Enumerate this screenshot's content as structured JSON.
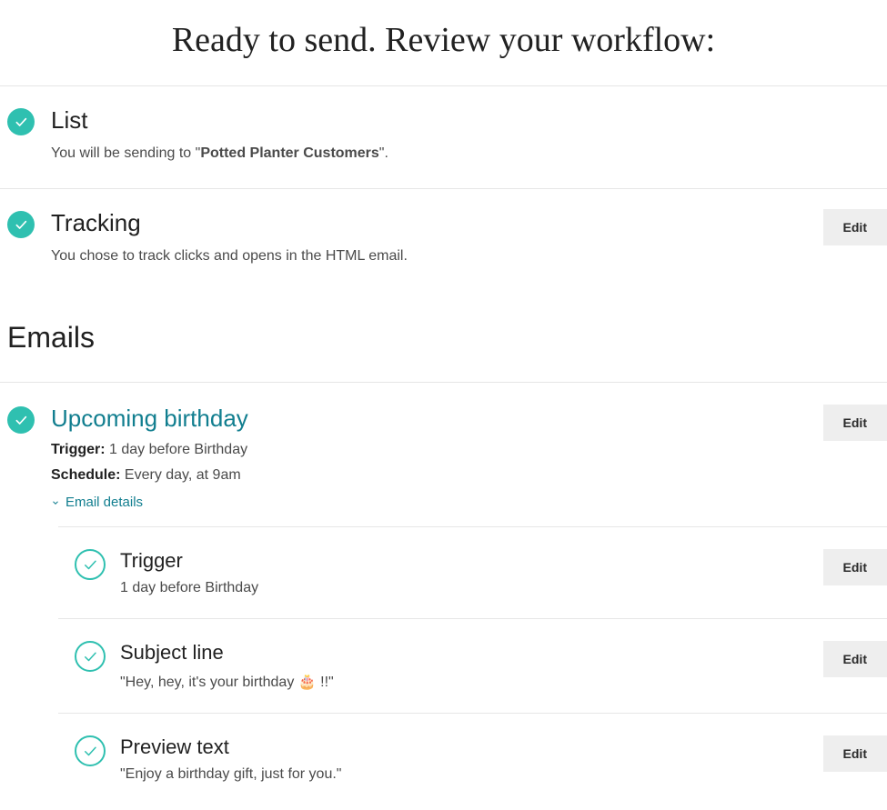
{
  "title": "Ready to send. Review your workflow:",
  "sections": {
    "list": {
      "title": "List",
      "desc_prefix": "You will be sending to \"",
      "desc_bold": "Potted Planter Customers",
      "desc_suffix": "\"."
    },
    "tracking": {
      "title": "Tracking",
      "desc": "You chose to track clicks and opens in the HTML email.",
      "edit": "Edit"
    }
  },
  "emails_heading": "Emails",
  "email": {
    "title": "Upcoming birthday",
    "trigger_label": "Trigger:",
    "trigger_value": " 1 day before Birthday",
    "schedule_label": "Schedule:",
    "schedule_value": " Every day, at 9am",
    "details_toggle": "Email details",
    "edit": "Edit"
  },
  "sub_items": [
    {
      "title": "Trigger",
      "desc": "1 day before Birthday",
      "edit": "Edit"
    },
    {
      "title": "Subject line",
      "desc": "\"Hey, hey, it's your birthday 🎂 !!\"",
      "edit": "Edit"
    },
    {
      "title": "Preview text",
      "desc": "\"Enjoy a birthday gift, just for you.\"",
      "edit": "Edit"
    }
  ]
}
